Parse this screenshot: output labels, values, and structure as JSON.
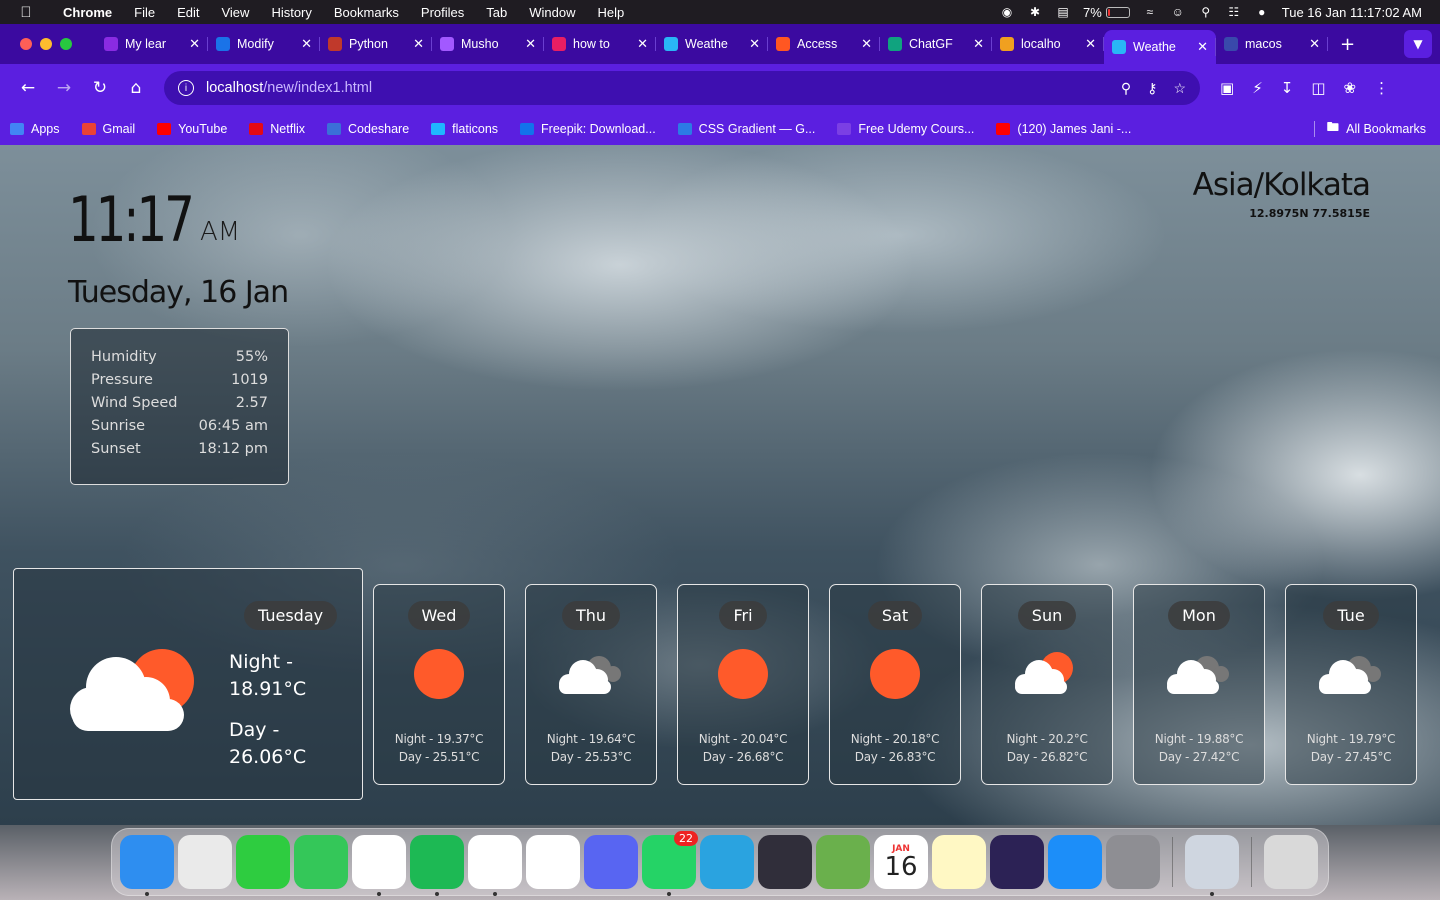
{
  "menubar": {
    "app_name": "Chrome",
    "items": [
      "File",
      "Edit",
      "View",
      "History",
      "Bookmarks",
      "Profiles",
      "Tab",
      "Window",
      "Help"
    ],
    "battery": "7%",
    "datetime": "Tue 16 Jan  11:17:02 AM"
  },
  "tabs": [
    {
      "title": "My lear",
      "color": "#8a2be2"
    },
    {
      "title": "Modify",
      "color": "#1a73e8"
    },
    {
      "title": "Python",
      "color": "#c0392b"
    },
    {
      "title": "Musho",
      "color": "#a259ff"
    },
    {
      "title": "how to",
      "color": "#e91e63"
    },
    {
      "title": "Weathe",
      "color": "#29b6f6"
    },
    {
      "title": "Access",
      "color": "#ff5722"
    },
    {
      "title": "ChatGF",
      "color": "#10a37f"
    },
    {
      "title": "localho",
      "color": "#f0a020"
    },
    {
      "title": "Weathe",
      "color": "#29b6f6",
      "active": true
    },
    {
      "title": "macos",
      "color": "#3949ab"
    }
  ],
  "toolbar": {
    "url_host": "localhost",
    "url_path": "/new/index1.html"
  },
  "bookmarks": [
    {
      "label": "Apps",
      "color": "#4285f4"
    },
    {
      "label": "Gmail",
      "color": "#ea4335"
    },
    {
      "label": "YouTube",
      "color": "#ff0000"
    },
    {
      "label": "Netflix",
      "color": "#e50914"
    },
    {
      "label": "Codeshare",
      "color": "#3b6fd8"
    },
    {
      "label": "flaticons",
      "color": "#1fb6ff"
    },
    {
      "label": "Freepik: Download...",
      "color": "#1273eb"
    },
    {
      "label": "CSS Gradient — G...",
      "color": "#2c7be5"
    },
    {
      "label": "Free Udemy Cours...",
      "color": "#7b3fe4"
    },
    {
      "label": "(120) James Jani -...",
      "color": "#ff0000"
    }
  ],
  "all_bookmarks": "All Bookmarks",
  "weather": {
    "time": "11:17",
    "ampm": "AM",
    "date": "Tuesday, 16 Jan",
    "timezone": "Asia/Kolkata",
    "coords": "12.8975N 77.5815E",
    "details": [
      {
        "label": "Humidity",
        "value": "55%"
      },
      {
        "label": "Pressure",
        "value": "1019"
      },
      {
        "label": "Wind Speed",
        "value": "2.57"
      },
      {
        "label": "Sunrise",
        "value": "06:45 am"
      },
      {
        "label": "Sunset",
        "value": "18:12 pm"
      }
    ],
    "today": {
      "day": "Tuesday",
      "night": "Night -",
      "night_temp": "18.91°C",
      "day_label": "Day -",
      "day_temp": "26.06°C"
    },
    "forecast": [
      {
        "day": "Wed",
        "icon": "sun-icon",
        "night": "Night - 19.37°C",
        "dayt": "Day - 25.51°C"
      },
      {
        "day": "Thu",
        "icon": "cloud-icon",
        "night": "Night - 19.64°C",
        "dayt": "Day - 25.53°C"
      },
      {
        "day": "Fri",
        "icon": "sun-icon",
        "night": "Night - 20.04°C",
        "dayt": "Day - 26.68°C"
      },
      {
        "day": "Sat",
        "icon": "sun-icon",
        "night": "Night - 20.18°C",
        "dayt": "Day - 26.83°C"
      },
      {
        "day": "Sun",
        "icon": "partly-cloudy-icon",
        "night": "Night - 20.2°C",
        "dayt": "Day - 26.82°C"
      },
      {
        "day": "Mon",
        "icon": "cloud-icon",
        "night": "Night - 19.88°C",
        "dayt": "Day - 27.42°C"
      },
      {
        "day": "Tue",
        "icon": "cloud-icon",
        "night": "Night - 19.79°C",
        "dayt": "Day - 27.45°C"
      }
    ]
  },
  "dock": [
    {
      "name": "finder",
      "color": "#2e8ef0"
    },
    {
      "name": "launchpad",
      "color": "#eaeaea"
    },
    {
      "name": "facetime",
      "color": "#2ecc40"
    },
    {
      "name": "messages",
      "color": "#34c759"
    },
    {
      "name": "chrome",
      "color": "#ffffff"
    },
    {
      "name": "spotify",
      "color": "#1db954"
    },
    {
      "name": "vscode",
      "color": "#ffffff"
    },
    {
      "name": "drive",
      "color": "#ffffff"
    },
    {
      "name": "discord",
      "color": "#5865f2"
    },
    {
      "name": "whatsapp",
      "color": "#25d366",
      "badge": "22"
    },
    {
      "name": "telegram",
      "color": "#2aa3e0"
    },
    {
      "name": "obs",
      "color": "#302e3a"
    },
    {
      "name": "android-studio",
      "color": "#6ab04c"
    },
    {
      "name": "calendar",
      "color": "#ffffff",
      "month": "JAN",
      "date": "16"
    },
    {
      "name": "notes",
      "color": "#fff8c4"
    },
    {
      "name": "eclipse",
      "color": "#2c2255"
    },
    {
      "name": "app-store",
      "color": "#1c8ef9"
    },
    {
      "name": "system-settings",
      "color": "#8e8e93"
    },
    {
      "name": "preview-settings",
      "color": "#cfd6e0"
    },
    {
      "name": "trash",
      "color": "#d9d9d9"
    }
  ]
}
